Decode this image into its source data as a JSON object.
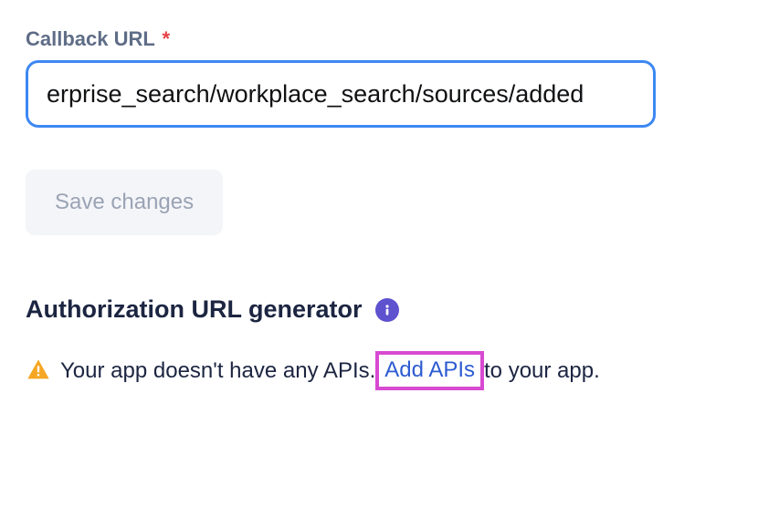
{
  "callback": {
    "label": "Callback URL",
    "required_marker": "*",
    "value": "erprise_search/workplace_search/sources/added"
  },
  "buttons": {
    "save": "Save changes"
  },
  "authorization": {
    "title": "Authorization URL generator"
  },
  "warning": {
    "prefix": "Your app doesn't have any APIs. ",
    "link": "Add APIs",
    "suffix": " to your app."
  },
  "icons": {
    "info": "info-icon",
    "warning": "warning-icon"
  },
  "colors": {
    "focus_border": "#3d88f3",
    "info_badge": "#5e52ce",
    "warning_fill": "#f5a623",
    "highlight": "#d84ad1",
    "link": "#2d5bd1"
  }
}
